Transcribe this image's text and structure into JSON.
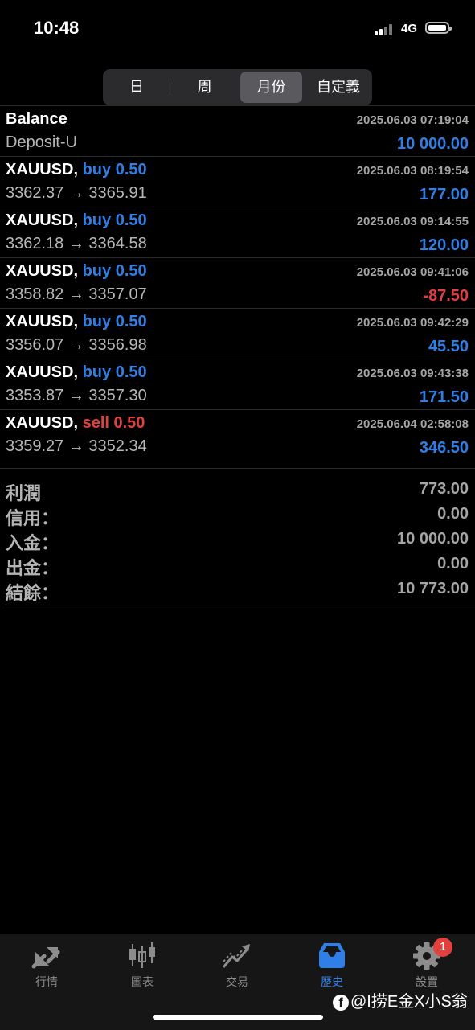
{
  "status_bar": {
    "time": "10:48",
    "network": "4G"
  },
  "period_tabs": [
    {
      "label": "日",
      "active": false
    },
    {
      "label": "周",
      "active": false
    },
    {
      "label": "月份",
      "active": true
    },
    {
      "label": "自定義",
      "active": false
    }
  ],
  "balance_entry": {
    "title": "Balance",
    "subtitle": "Deposit-U",
    "datetime": "2025.06.03 07:19:04",
    "amount": "10 000.00"
  },
  "trades": [
    {
      "symbol": "XAUUSD,",
      "side": "buy",
      "volume": "0.50",
      "prices": "3362.37 → 3365.91",
      "datetime": "2025.06.03 08:19:54",
      "profit": "177.00"
    },
    {
      "symbol": "XAUUSD,",
      "side": "buy",
      "volume": "0.50",
      "prices": "3362.18 → 3364.58",
      "datetime": "2025.06.03 09:14:55",
      "profit": "120.00"
    },
    {
      "symbol": "XAUUSD,",
      "side": "buy",
      "volume": "0.50",
      "prices": "3358.82 → 3357.07",
      "datetime": "2025.06.03 09:41:06",
      "profit": "-87.50"
    },
    {
      "symbol": "XAUUSD,",
      "side": "buy",
      "volume": "0.50",
      "prices": "3356.07 → 3356.98",
      "datetime": "2025.06.03 09:42:29",
      "profit": "45.50"
    },
    {
      "symbol": "XAUUSD,",
      "side": "buy",
      "volume": "0.50",
      "prices": "3353.87 → 3357.30",
      "datetime": "2025.06.03 09:43:38",
      "profit": "171.50"
    },
    {
      "symbol": "XAUUSD,",
      "side": "sell",
      "volume": "0.50",
      "prices": "3359.27 → 3352.34",
      "datetime": "2025.06.04 02:58:08",
      "profit": "346.50"
    }
  ],
  "summary": [
    {
      "label": "利潤",
      "value": "773.00"
    },
    {
      "label": "信用：",
      "value": "0.00"
    },
    {
      "label": "入金：",
      "value": "10 000.00"
    },
    {
      "label": "出金：",
      "value": "0.00"
    },
    {
      "label": "結餘：",
      "value": "10 773.00"
    }
  ],
  "tab_bar": {
    "items": [
      {
        "label": "行情",
        "icon": "quotes-arrows-icon",
        "active": false
      },
      {
        "label": "圖表",
        "icon": "candlestick-chart-icon",
        "active": false
      },
      {
        "label": "交易",
        "icon": "trade-trend-icon",
        "active": false
      },
      {
        "label": "歷史",
        "icon": "history-inbox-icon",
        "active": true
      },
      {
        "label": "設置",
        "icon": "gear-icon",
        "active": false,
        "badge": "1"
      }
    ]
  },
  "watermark": {
    "text": "@I捞E金X小S翁",
    "icon": "facebook-icon"
  },
  "colors": {
    "accent_blue": "#2f7fe6",
    "loss_red": "#e0413d",
    "background": "#000000"
  }
}
